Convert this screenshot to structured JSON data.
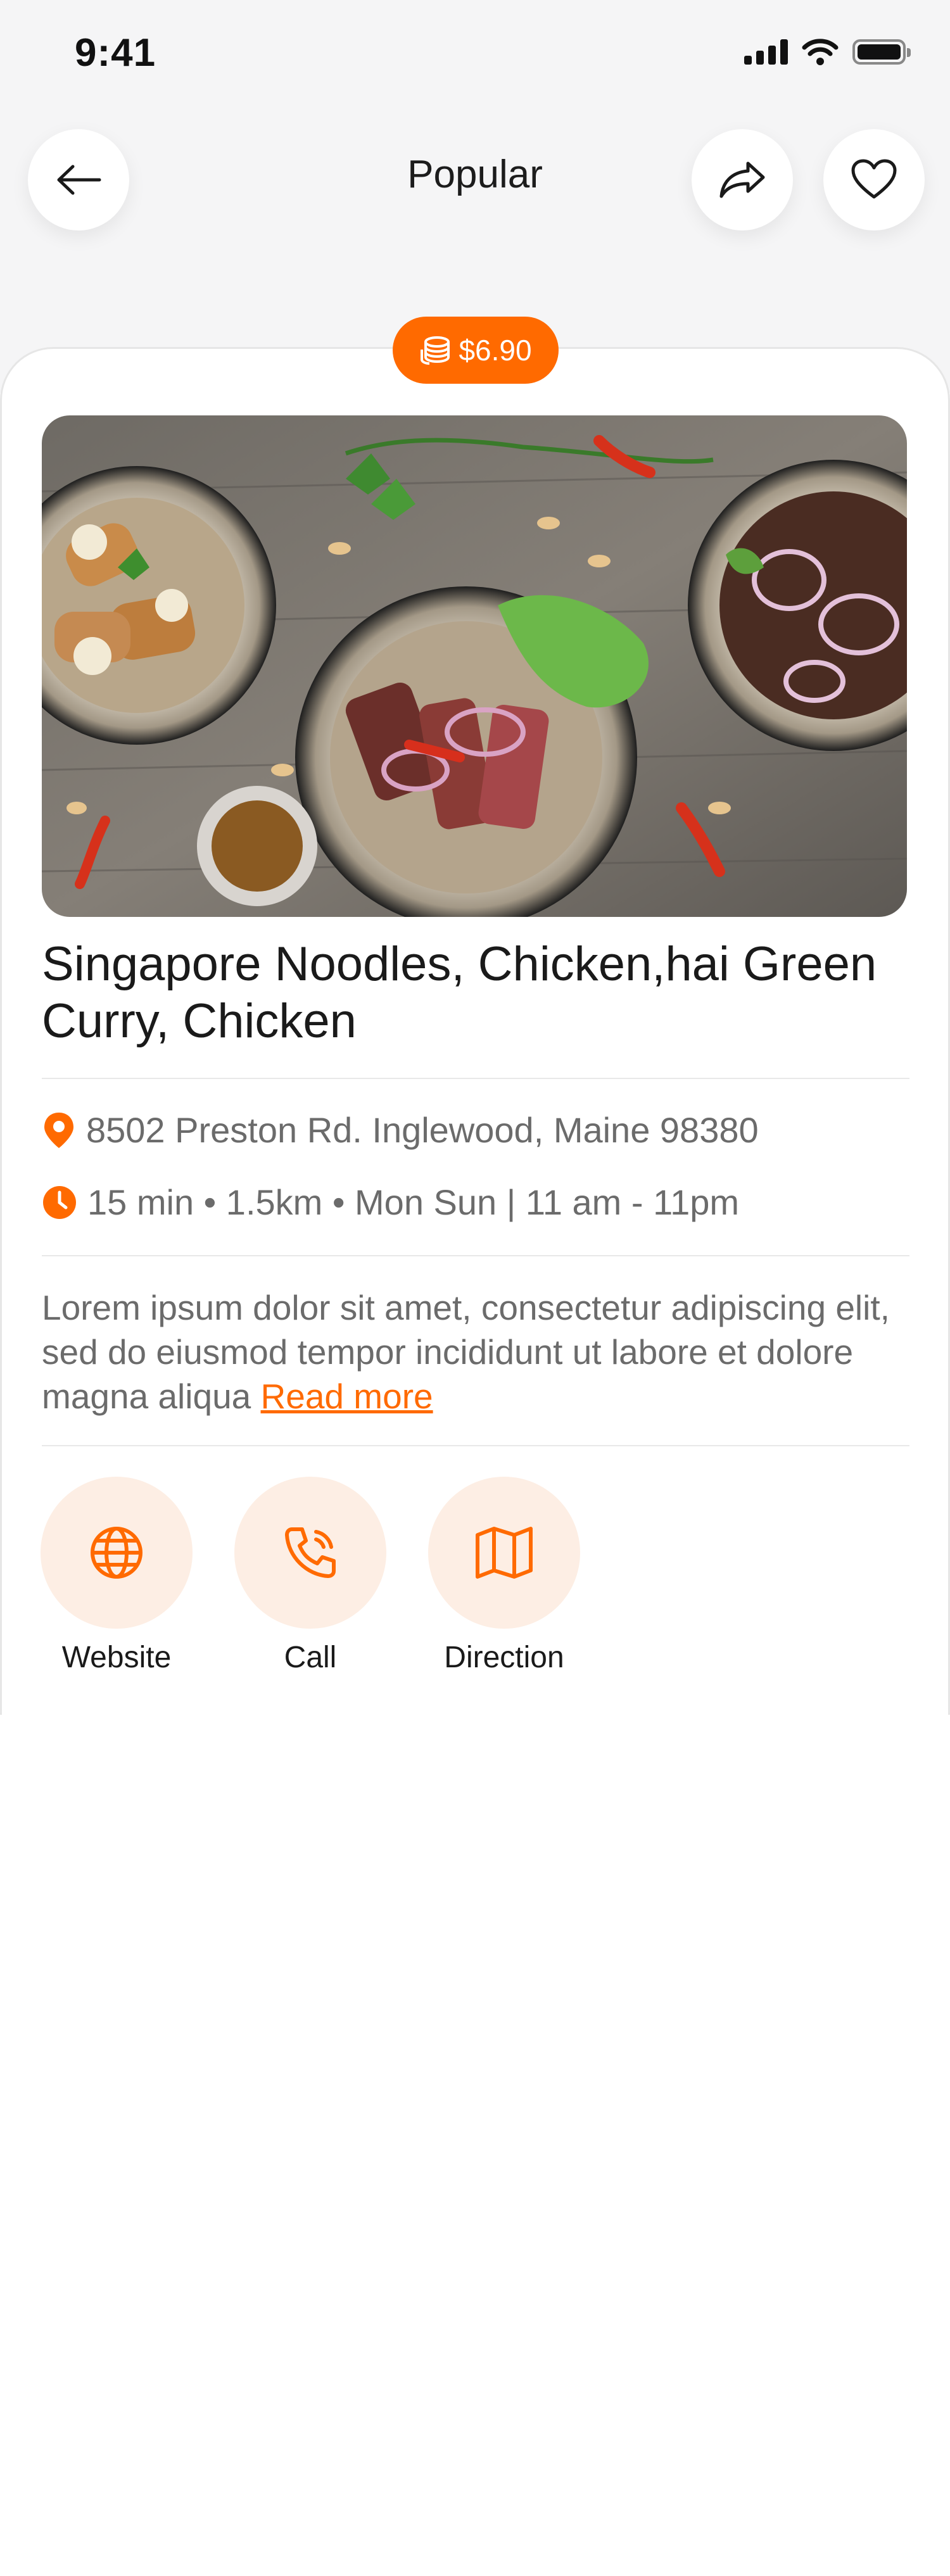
{
  "status_bar": {
    "time": "9:41"
  },
  "header": {
    "title": "Popular"
  },
  "price": {
    "label": "$6.90"
  },
  "item": {
    "title": "Singapore Noodles, Chicken,hai Green Curry, Chicken",
    "address": "8502 Preston Rd. Inglewood, Maine 98380",
    "details": "15 min • 1.5km • Mon Sun | 11 am - 11pm",
    "description": "Lorem ipsum dolor sit amet, consectetur adipiscing elit, sed do eiusmod tempor incididunt ut labore et dolore magna aliqua",
    "read_more": "Read more"
  },
  "actions": [
    {
      "label": "Website",
      "icon": "globe-icon"
    },
    {
      "label": "Call",
      "icon": "phone-icon"
    },
    {
      "label": "Direction",
      "icon": "map-icon"
    }
  ],
  "colors": {
    "accent": "#ff6a00",
    "accent_light": "#fdeee4"
  }
}
